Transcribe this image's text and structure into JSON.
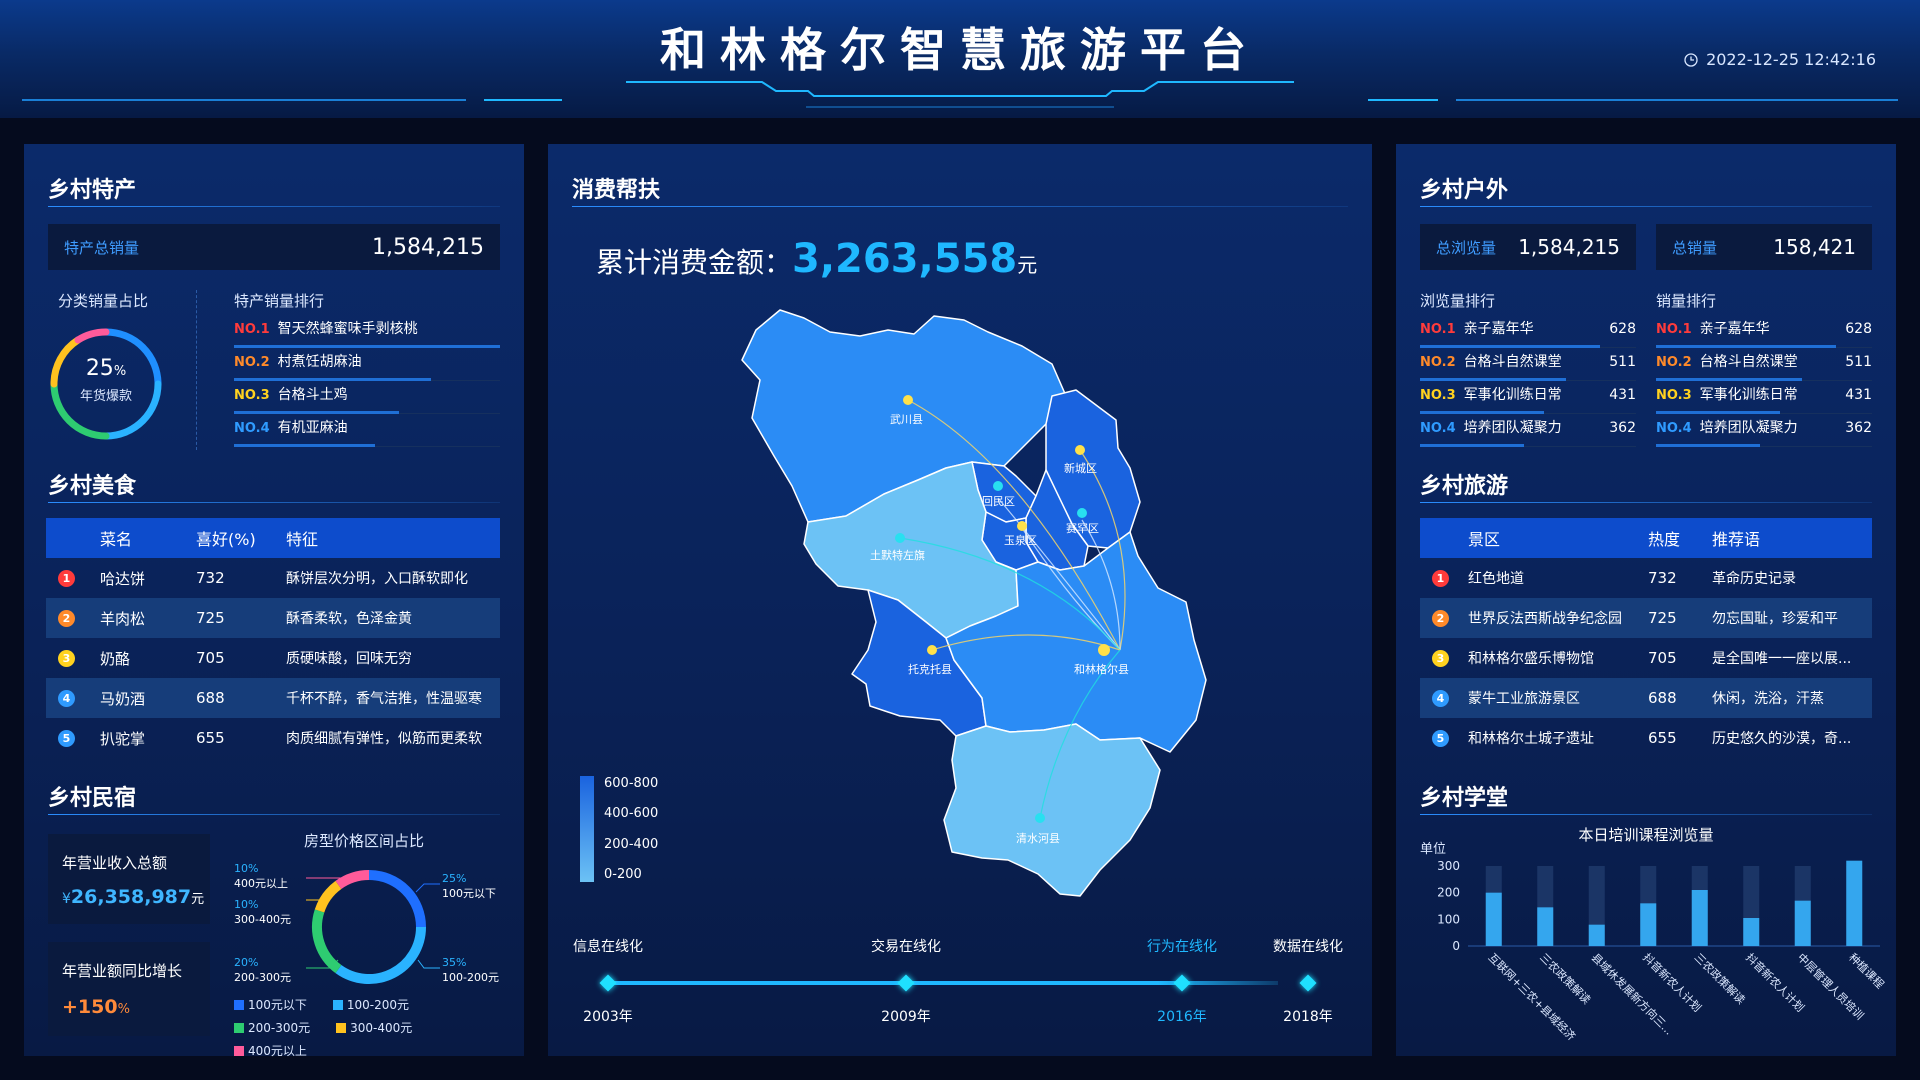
{
  "header": {
    "title": "和林格尔智慧旅游平台",
    "datetime": "2022-12-25 12:42:16"
  },
  "colors": {
    "accent": "#1fb8ff",
    "no1": "#ff3b3b",
    "no2": "#ff8a2a",
    "no3": "#ffd21f",
    "no4": "#2f9bff"
  },
  "specialty": {
    "title": "乡村特产",
    "total_label": "特产总销量",
    "total_value": "1,584,215",
    "ratio_title": "分类销量占比",
    "ratio_value": "25",
    "ratio_unit": "%",
    "ratio_label": "年货爆款",
    "rank_title": "特产销量排行",
    "ranking": [
      {
        "no": "NO.1",
        "name": "智天然蜂蜜味手剥核桃",
        "share": 1.0
      },
      {
        "no": "NO.2",
        "name": "村煮饪胡麻油",
        "share": 0.74
      },
      {
        "no": "NO.3",
        "name": "台格斗土鸡",
        "share": 0.62
      },
      {
        "no": "NO.4",
        "name": "有机亚麻油",
        "share": 0.53
      }
    ]
  },
  "food": {
    "title": "乡村美食",
    "headers": [
      "菜名",
      "喜好(%)",
      "特征"
    ],
    "rows": [
      {
        "rank": "1",
        "name": "哈达饼",
        "like": "732",
        "feature": "酥饼层次分明，入口酥软即化"
      },
      {
        "rank": "2",
        "name": "羊肉松",
        "like": "725",
        "feature": "酥香柔软，色泽金黄"
      },
      {
        "rank": "3",
        "name": "奶酪",
        "like": "705",
        "feature": "质硬味酸，回味无穷"
      },
      {
        "rank": "4",
        "name": "马奶酒",
        "like": "688",
        "feature": "千杯不醉，香气洁推，性温驱寒"
      },
      {
        "rank": "5",
        "name": "扒驼掌",
        "like": "655",
        "feature": "肉质细腻有弹性，似筋而更柔软"
      }
    ]
  },
  "homestay": {
    "title": "乡村民宿",
    "revenue_label": "年营业收入总额",
    "revenue_prefix": "¥",
    "revenue_value": "26,358,987",
    "revenue_unit": "元",
    "growth_label": "年营业额同比增长",
    "growth_value": "+150",
    "growth_unit": "%",
    "price_title": "房型价格区间占比",
    "price_slices": [
      {
        "pct": "35%",
        "label": "100-200元",
        "value": 35,
        "color": "#2ab3ff"
      },
      {
        "pct": "25%",
        "label": "100元以下",
        "value": 25,
        "color": "#1f6fff"
      },
      {
        "pct": "20%",
        "label": "200-300元",
        "value": 20,
        "color": "#2ecc71"
      },
      {
        "pct": "10%",
        "label": "300-400元",
        "value": 10,
        "color": "#ffc21f"
      },
      {
        "pct": "10%",
        "label": "400元以上",
        "value": 10,
        "color": "#ff5b9a"
      }
    ],
    "legend": [
      "100元以下",
      "100-200元",
      "200-300元",
      "300-400元",
      "400元以上"
    ]
  },
  "consume": {
    "title": "消费帮扶",
    "total_label": "累计消费金额：",
    "total_value": "3,263,558",
    "total_unit": "元",
    "map_legend": [
      "600-800",
      "400-600",
      "200-400",
      "0-200"
    ],
    "places": [
      "武川县",
      "新城区",
      "回民区",
      "赛罕区",
      "玉泉区",
      "土默特左旗",
      "托克托县",
      "和林格尔县",
      "清水河县"
    ],
    "timeline": [
      {
        "label": "信息在线化",
        "year": "2003年"
      },
      {
        "label": "交易在线化",
        "year": "2009年"
      },
      {
        "label": "行为在线化",
        "year": "2016年"
      },
      {
        "label": "数据在线化",
        "year": "2018年"
      }
    ]
  },
  "outdoor": {
    "title": "乡村户外",
    "views_label": "总浏览量",
    "views_value": "1,584,215",
    "sales_label": "总销量",
    "sales_value": "158,421",
    "views_rank_title": "浏览量排行",
    "sales_rank_title": "销量排行",
    "views_rank": [
      {
        "no": "NO.1",
        "name": "亲子嘉年华",
        "count": "628",
        "share": 1.0
      },
      {
        "no": "NO.2",
        "name": "台格斗自然课堂",
        "count": "511",
        "share": 0.81
      },
      {
        "no": "NO.3",
        "name": "军事化训练日常",
        "count": "431",
        "share": 0.69
      },
      {
        "no": "NO.4",
        "name": "培养团队凝聚力",
        "count": "362",
        "share": 0.58
      }
    ],
    "sales_rank": [
      {
        "no": "NO.1",
        "name": "亲子嘉年华",
        "count": "628",
        "share": 1.0
      },
      {
        "no": "NO.2",
        "name": "台格斗自然课堂",
        "count": "511",
        "share": 0.81
      },
      {
        "no": "NO.3",
        "name": "军事化训练日常",
        "count": "431",
        "share": 0.69
      },
      {
        "no": "NO.4",
        "name": "培养团队凝聚力",
        "count": "362",
        "share": 0.58
      }
    ]
  },
  "tourism": {
    "title": "乡村旅游",
    "headers": [
      "景区",
      "热度",
      "推荐语"
    ],
    "rows": [
      {
        "rank": "1",
        "name": "红色地道",
        "hot": "732",
        "slogan": "革命历史记录"
      },
      {
        "rank": "2",
        "name": "世界反法西斯战争纪念园",
        "hot": "725",
        "slogan": "勿忘国耻，珍爱和平"
      },
      {
        "rank": "3",
        "name": "和林格尔盛乐博物馆",
        "hot": "705",
        "slogan": "是全国唯一一座以展..."
      },
      {
        "rank": "4",
        "name": "蒙牛工业旅游景区",
        "hot": "688",
        "slogan": "休闲，洗浴，汗蒸"
      },
      {
        "rank": "5",
        "name": "和林格尔土城子遗址",
        "hot": "655",
        "slogan": "历史悠久的沙漠，奇..."
      }
    ]
  },
  "school": {
    "title": "乡村学堂",
    "chart_title": "本日培训课程浏览量",
    "unit_label": "单位"
  },
  "chart_data": {
    "type": "bar",
    "title": "本日培训课程浏览量",
    "ylabel": "单位",
    "ylim": [
      0,
      300
    ],
    "yticks": [
      "300",
      "200",
      "100",
      "0"
    ],
    "categories": [
      "互联网+三农+县域经济",
      "三农政策解读",
      "县域休发展新方向三...",
      "抖音新农人计划",
      "三农政策解读",
      "抖音新农人计划",
      "中层管理人员培训",
      "种植课程"
    ],
    "values": [
      200,
      145,
      80,
      160,
      210,
      105,
      170,
      320
    ],
    "max_bar": 300
  }
}
